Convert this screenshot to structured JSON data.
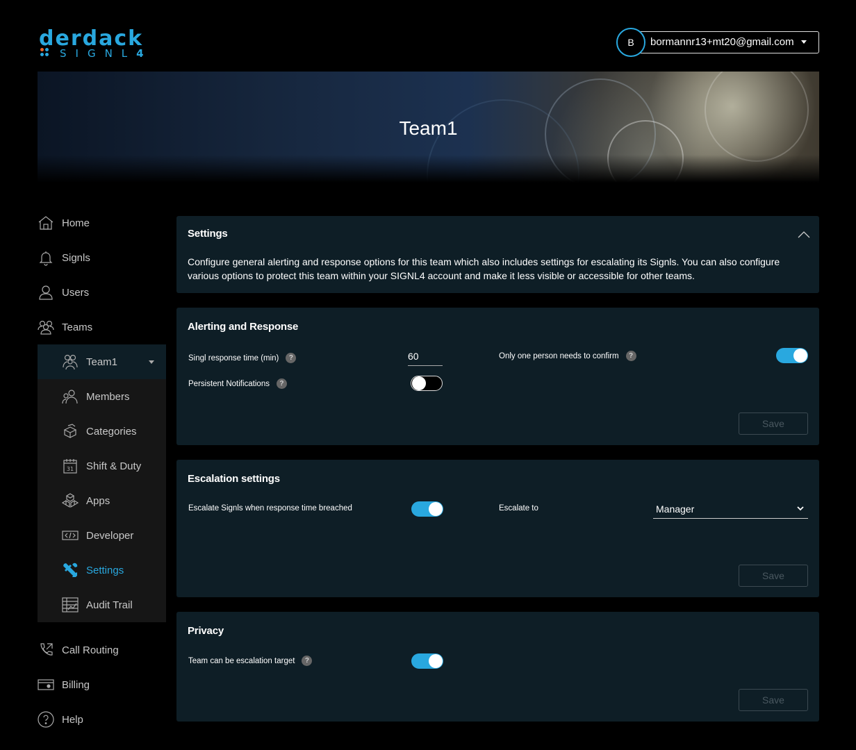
{
  "brand": {
    "name_top": "DERDACK",
    "name_bottom": "SIGNL",
    "name_bottom_suffix": "4"
  },
  "user": {
    "initial": "B",
    "email": "bormannr13+mt20@gmail.com"
  },
  "banner": {
    "title": "Team1"
  },
  "nav": {
    "main_top": [
      {
        "label": "Home",
        "icon": "home-icon"
      },
      {
        "label": "Signls",
        "icon": "bell-icon"
      },
      {
        "label": "Users",
        "icon": "user-icon"
      },
      {
        "label": "Teams",
        "icon": "teams-icon"
      }
    ],
    "team": {
      "label": "Team1",
      "icon": "team-icon"
    },
    "team_items": [
      {
        "label": "Members",
        "icon": "members-icon"
      },
      {
        "label": "Categories",
        "icon": "categories-icon"
      },
      {
        "label": "Shift & Duty",
        "icon": "calendar-icon",
        "calendar_day": "31"
      },
      {
        "label": "Apps",
        "icon": "apps-icon"
      },
      {
        "label": "Developer",
        "icon": "code-icon"
      },
      {
        "label": "Settings",
        "icon": "wrench-icon",
        "active": true
      },
      {
        "label": "Audit Trail",
        "icon": "audit-icon"
      }
    ],
    "main_bottom": [
      {
        "label": "Call Routing",
        "icon": "phone-icon"
      },
      {
        "label": "Billing",
        "icon": "billing-icon"
      },
      {
        "label": "Help",
        "icon": "help-icon"
      }
    ]
  },
  "settings_card": {
    "title": "Settings",
    "description": "Configure general alerting and response options for this team which also includes settings for escalating its Signls. You can also configure various options to protect this team within your SIGNL4 account and make it less visible or accessible for other teams."
  },
  "alerting": {
    "title": "Alerting and Response",
    "response_time_label": "Singl response time (min)",
    "response_time_value": "60",
    "persistent_label": "Persistent Notifications",
    "persistent_on": false,
    "one_person_label": "Only one person needs to confirm",
    "one_person_on": true,
    "save_label": "Save"
  },
  "escalation": {
    "title": "Escalation settings",
    "escalate_label": "Escalate Signls when response time breached",
    "escalate_on": true,
    "escalate_to_label": "Escalate to",
    "escalate_to_value": "Manager",
    "save_label": "Save"
  },
  "privacy": {
    "title": "Privacy",
    "target_label": "Team can be escalation target",
    "target_on": true,
    "save_label": "Save"
  },
  "help_glyph": "?",
  "colors": {
    "accent": "#29a8df",
    "card": "#0e1e26",
    "background": "#000000"
  }
}
